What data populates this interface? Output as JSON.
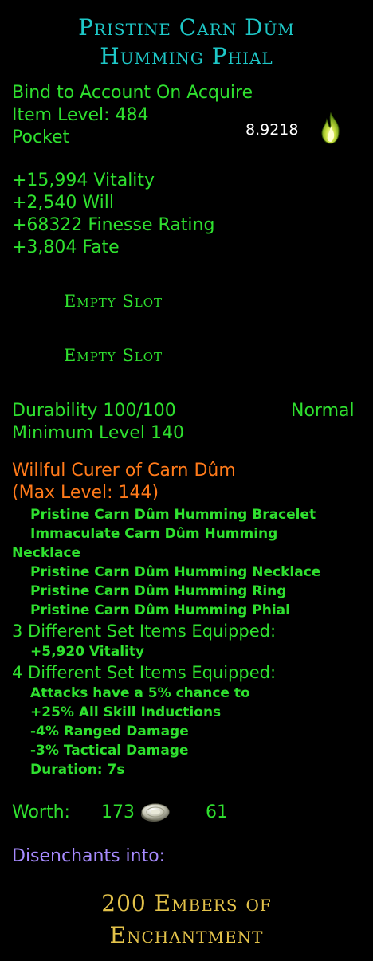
{
  "item": {
    "title_line1": "Pristine Carn Dûm",
    "title_line2": "Humming Phial",
    "binding": "Bind to Account On Acquire",
    "item_level": "Item Level: 484",
    "slot_type": "Pocket",
    "essence_value": "8.9218",
    "stats": [
      "+15,994 Vitality",
      "+2,540 Will",
      "+68322 Finesse Rating",
      "+3,804 Fate"
    ],
    "sockets": [
      "Empty Slot",
      "Empty Slot"
    ],
    "durability": "Durability 100/100",
    "durability_status": "Normal",
    "min_level": "Minimum Level 140"
  },
  "set": {
    "name": "Willful Curer of Carn Dûm",
    "max_level": "(Max Level: 144)",
    "pieces": [
      "Pristine Carn Dûm Humming Bracelet",
      "Immaculate Carn Dûm Humming",
      "Necklace",
      "Pristine Carn Dûm Humming Necklace",
      "Pristine Carn Dûm Humming Ring",
      "Pristine Carn Dûm Humming Phial"
    ],
    "bonus3_header": "3 Different Set Items Equipped:",
    "bonus3": [
      "+5,920 Vitality"
    ],
    "bonus4_header": "4 Different Set Items Equipped:",
    "bonus4": [
      "Attacks have a 5% chance to",
      "+25% All Skill Inductions",
      "-4% Ranged Damage",
      "-3% Tactical Damage",
      "Duration: 7s"
    ]
  },
  "worth": {
    "label": "Worth:",
    "silver": "173",
    "copper": "61"
  },
  "disenchant": {
    "label": "Disenchants into:",
    "result_line1": "200 Embers of",
    "result_line2": "Enchantment"
  },
  "icons": {
    "essence": "flame-icon",
    "currency": "silver-coin-icon"
  },
  "colors": {
    "title": "#1ec8c8",
    "stat_text": "#2fe02f",
    "set_name": "#ff7a1a",
    "disenchant_label": "#a78bff",
    "disenchant_result": "#e3c24a",
    "background": "#000000"
  }
}
